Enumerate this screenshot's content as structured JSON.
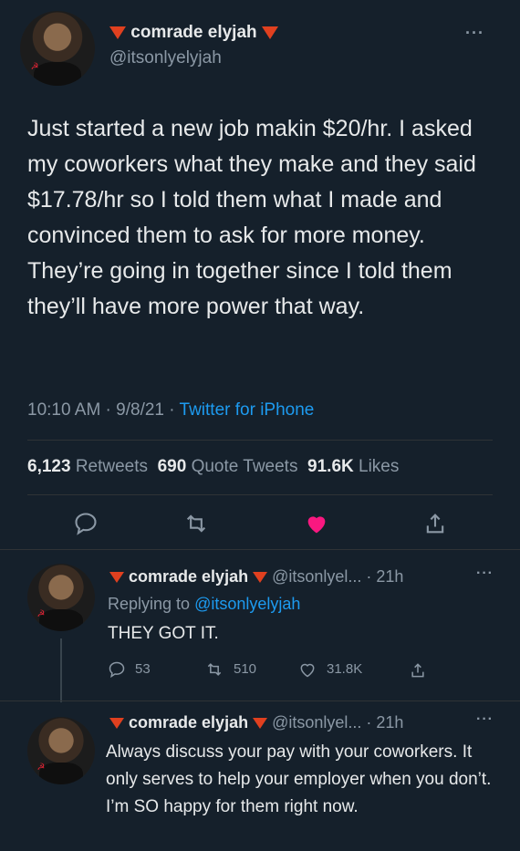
{
  "main_tweet": {
    "display_name": "comrade elyjah",
    "handle": "@itsonlyelyjah",
    "more": "···",
    "text": "Just started a new job makin $20/hr. I asked my coworkers what they make and they said $17.78/hr so I told them what I made and convinced them to ask for more money. They’re going in together since I told them they’ll have more power that way.",
    "time": "10:10 AM · 9/8/21 ·",
    "source": "Twitter for iPhone",
    "stats": {
      "retweets_count": "6,123",
      "retweets_label": "Retweets",
      "quotes_count": "690",
      "quotes_label": "Quote Tweets",
      "likes_count": "91.6K",
      "likes_label": "Likes"
    },
    "liked_color": "#f91880"
  },
  "reply_1": {
    "display_name": "comrade elyjah",
    "handle_time": "@itsonlyel... · 21h",
    "more": "···",
    "replying_prefix": "Replying to",
    "replying_handle": "@itsonlyelyjah",
    "text": "THEY GOT IT.",
    "replies": "53",
    "retweets": "510",
    "likes": "31.8K"
  },
  "reply_2": {
    "display_name": "comrade elyjah",
    "handle_time": "@itsonlyel... · 21h",
    "more": "···",
    "text": "Always discuss your pay with your coworkers. It only serves to help your employer when you don’t. I’m SO happy for them right now."
  }
}
